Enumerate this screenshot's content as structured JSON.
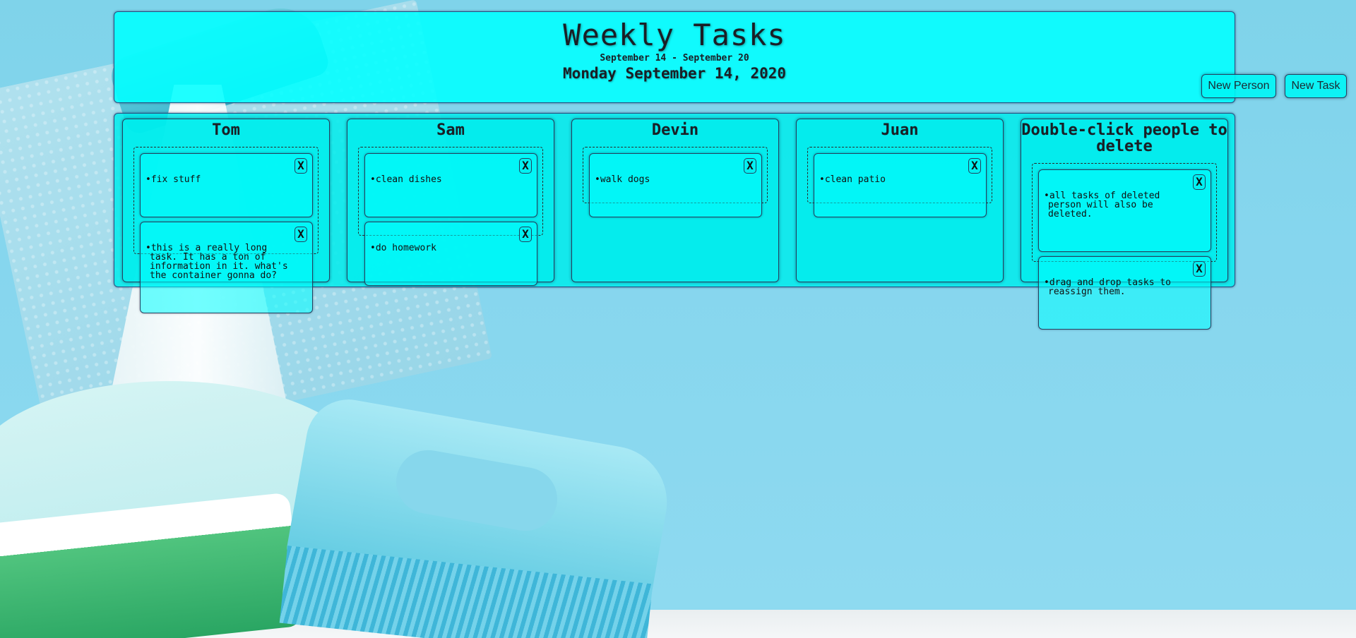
{
  "header": {
    "title": "Weekly Tasks",
    "week_range": "September 14 - September 20",
    "today": "Monday September 14, 2020",
    "new_person_label": "New Person",
    "new_task_label": "New Task"
  },
  "columns": [
    {
      "name": "Tom",
      "tasks": [
        {
          "text": "•fix stuff",
          "close": "X"
        },
        {
          "text": "•this is a really long task. It has a ton of information in it. what's the container gonna do?",
          "close": "X"
        }
      ]
    },
    {
      "name": "Sam",
      "tasks": [
        {
          "text": "•clean dishes",
          "close": "X"
        },
        {
          "text": "•do homework",
          "close": "X"
        }
      ]
    },
    {
      "name": "Devin",
      "tasks": [
        {
          "text": "•walk dogs",
          "close": "X"
        }
      ]
    },
    {
      "name": "Juan",
      "tasks": [
        {
          "text": "•clean patio",
          "close": "X"
        }
      ]
    },
    {
      "name": "Double-click people to delete",
      "tasks": [
        {
          "text": "•all tasks of deleted person will also be deleted.",
          "close": "X"
        },
        {
          "text": "•drag and drop tasks to reassign them.",
          "close": "X"
        }
      ]
    }
  ],
  "colors": {
    "panel": "#00ffff",
    "border": "#24415f",
    "text": "#1a1f26"
  }
}
